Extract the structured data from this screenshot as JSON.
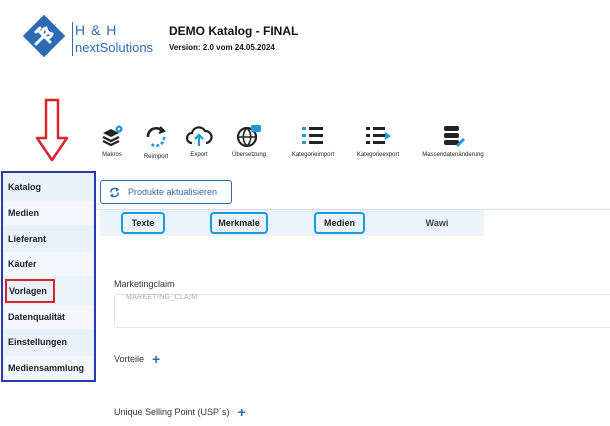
{
  "header": {
    "logo_line1": "H & H",
    "logo_line2": "nextSolutions",
    "title": "DEMO Katalog - FINAL",
    "version": "Version: 2.0 vom 24.05.2024"
  },
  "toolbar": {
    "items": [
      {
        "label": "Makros",
        "icon": "layers-gear-icon"
      },
      {
        "label": "Reimport",
        "icon": "refresh-icon"
      },
      {
        "label": "Export",
        "icon": "cloud-upload-icon"
      },
      {
        "label": "Übersetzung",
        "icon": "globe-chat-icon"
      },
      {
        "label": "Kategorieimport",
        "icon": "list-import-icon"
      },
      {
        "label": "Kategorieexport",
        "icon": "list-export-icon"
      },
      {
        "label": "Massendatenänderung",
        "icon": "database-edit-icon"
      }
    ]
  },
  "sidebar": {
    "items": [
      {
        "label": "Katalog"
      },
      {
        "label": "Medien"
      },
      {
        "label": "Lieferant"
      },
      {
        "label": "Käufer"
      },
      {
        "label": "Vorlagen"
      },
      {
        "label": "Datenqualität"
      },
      {
        "label": "Einstellungen"
      },
      {
        "label": "Mediensammlung"
      }
    ]
  },
  "main": {
    "refresh_label": "Produkte aktualisieren",
    "tabs": [
      {
        "label": "Texte"
      },
      {
        "label": "Merkmale"
      },
      {
        "label": "Medien"
      },
      {
        "label": "Wawi"
      }
    ],
    "marketing_label": "Marketingclaim",
    "marketing_placeholder": "MARKETING_CLAIM",
    "vorteile_label": "Vorteile",
    "usp_label": "Unique Selling Point (USP´s)"
  },
  "colors": {
    "brand": "#2e6bb5",
    "sidebar_border": "#2b3aa8",
    "annotation_red": "#d9232d",
    "tab_highlight": "#1a9ad7"
  }
}
